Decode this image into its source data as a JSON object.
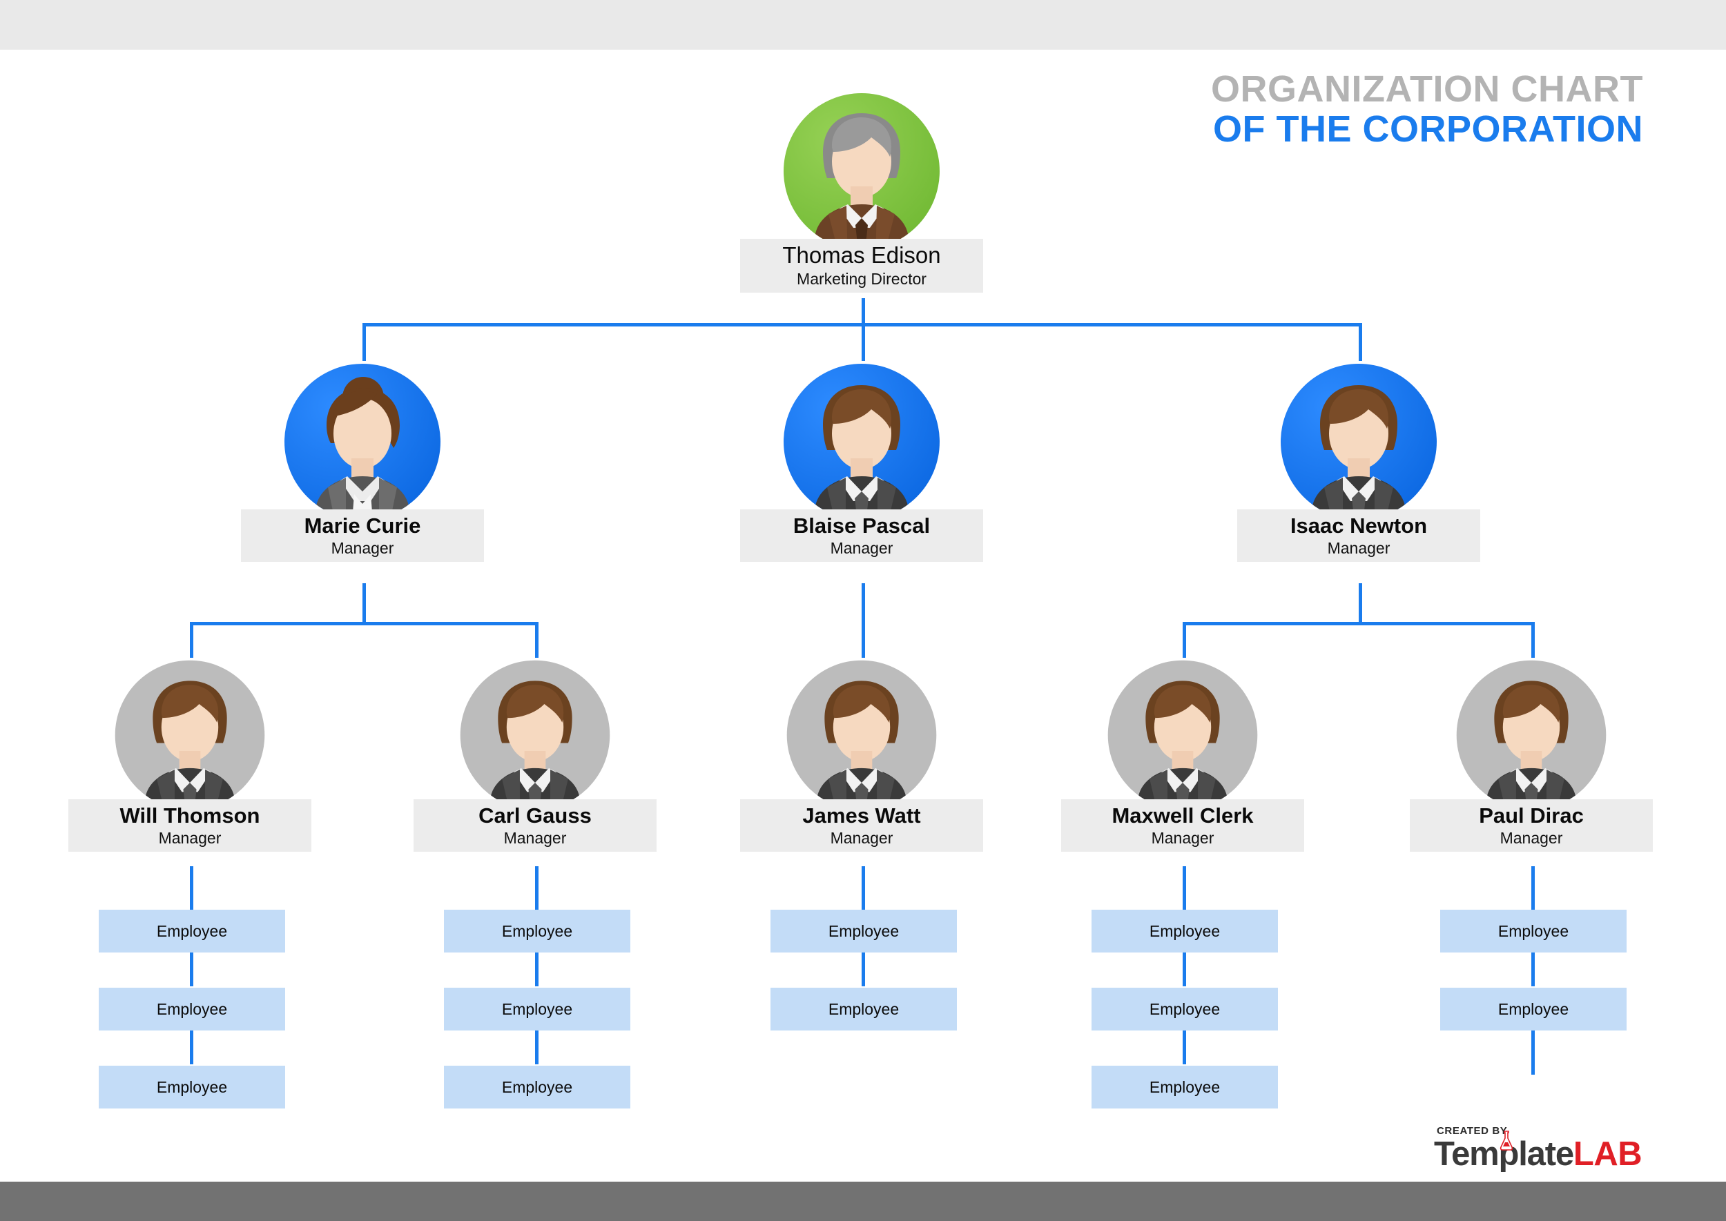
{
  "title": {
    "line1": "ORGANIZATION CHART",
    "line2": "OF THE CORPORATION",
    "line1_color": "#b3b3b3",
    "line2_color": "#1a7ced"
  },
  "theme": {
    "connector_color": "#1a7ced",
    "label_box_color": "#ececec",
    "employee_box_color": "#c3dcf7",
    "top_bar_color": "#e9e9e9",
    "bottom_bar_color": "#727272",
    "director_circle_color": "#7cc242",
    "manager_circle_color": "#1a7ced",
    "supervisor_circle_color": "#bcbcbc"
  },
  "chart_data": {
    "type": "org_chart",
    "title": "ORGANIZATION CHART OF THE CORPORATION",
    "levels": 4,
    "nodes": [
      {
        "id": "n1",
        "name": "Thomas Edison",
        "role": "Marketing Director",
        "level": 1,
        "avatar": "director-avatar-green",
        "parent": null
      },
      {
        "id": "n2",
        "name": "Marie Curie",
        "role": "Manager",
        "level": 2,
        "avatar": "manager-avatar-female-blue",
        "parent": "n1"
      },
      {
        "id": "n3",
        "name": "Blaise Pascal",
        "role": "Manager",
        "level": 2,
        "avatar": "manager-avatar-male-blue",
        "parent": "n1"
      },
      {
        "id": "n4",
        "name": "Isaac Newton",
        "role": "Manager",
        "level": 2,
        "avatar": "manager-avatar-male-blue",
        "parent": "n1"
      },
      {
        "id": "n5",
        "name": "Will Thomson",
        "role": "Manager",
        "level": 3,
        "avatar": "supervisor-avatar-male-gray",
        "parent": "n2"
      },
      {
        "id": "n6",
        "name": "Carl Gauss",
        "role": "Manager",
        "level": 3,
        "avatar": "supervisor-avatar-male-gray",
        "parent": "n2"
      },
      {
        "id": "n7",
        "name": "James Watt",
        "role": "Manager",
        "level": 3,
        "avatar": "supervisor-avatar-male-gray",
        "parent": "n3"
      },
      {
        "id": "n8",
        "name": "Maxwell Clerk",
        "role": "Manager",
        "level": 3,
        "avatar": "supervisor-avatar-male-gray",
        "parent": "n4"
      },
      {
        "id": "n9",
        "name": "Paul Dirac",
        "role": "Manager",
        "level": 3,
        "avatar": "supervisor-avatar-male-gray",
        "parent": "n4"
      }
    ],
    "employee_columns": [
      {
        "parent": "n5",
        "parent_name": "Will Thomson",
        "count": 3
      },
      {
        "parent": "n6",
        "parent_name": "Carl Gauss",
        "count": 3
      },
      {
        "parent": "n7",
        "parent_name": "James Watt",
        "count": 2
      },
      {
        "parent": "n8",
        "parent_name": "Maxwell Clerk",
        "count": 3
      },
      {
        "parent": "n9",
        "parent_name": "Paul Dirac",
        "count": 2
      }
    ]
  },
  "nodes": {
    "director": {
      "name": "Thomas Edison",
      "role": "Marketing Director"
    },
    "managers": [
      {
        "name": "Marie Curie",
        "role": "Manager"
      },
      {
        "name": "Blaise Pascal",
        "role": "Manager"
      },
      {
        "name": "Isaac Newton",
        "role": "Manager"
      }
    ],
    "supervisors": [
      {
        "name": "Will Thomson",
        "role": "Manager"
      },
      {
        "name": "Carl Gauss",
        "role": "Manager"
      },
      {
        "name": "James Watt",
        "role": "Manager"
      },
      {
        "name": "Maxwell Clerk",
        "role": "Manager"
      },
      {
        "name": "Paul Dirac",
        "role": "Manager"
      }
    ]
  },
  "employees": {
    "label": "Employee",
    "col1": [
      "Employee",
      "Employee",
      "Employee"
    ],
    "col2": [
      "Employee",
      "Employee",
      "Employee"
    ],
    "col3": [
      "Employee",
      "Employee"
    ],
    "col4": [
      "Employee",
      "Employee",
      "Employee"
    ],
    "col5": [
      "Employee",
      "Employee"
    ]
  },
  "logo": {
    "created_by": "CREATED BY",
    "template": "Template",
    "lab": "LAB"
  }
}
